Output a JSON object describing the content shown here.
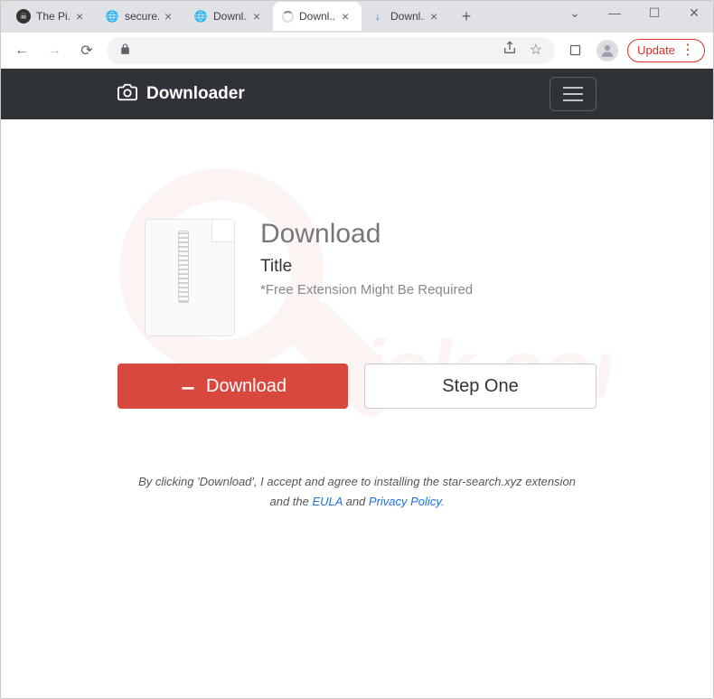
{
  "window": {
    "controls": {
      "dropdown": "⌄",
      "minimize": "—",
      "maximize": "☐",
      "close": "✕"
    }
  },
  "tabs": [
    {
      "label": "The Pi...",
      "favicon": "pirate"
    },
    {
      "label": "secure...",
      "favicon": "globe"
    },
    {
      "label": "Downl...",
      "favicon": "globe"
    },
    {
      "label": "Downl...",
      "favicon": "none",
      "active": true
    },
    {
      "label": "Downl...",
      "favicon": "download"
    }
  ],
  "toolbar": {
    "update_label": "Update"
  },
  "header": {
    "brand": "Downloader"
  },
  "page": {
    "heading": "Download",
    "subheading": "Title",
    "note": "*Free Extension Might Be Required",
    "download_btn": "Download",
    "step_btn": "Step One",
    "disclaimer_pre": "By clicking 'Download', I accept and agree to installing the star-search.xyz extension and the ",
    "eula": "EULA",
    "and": " and ",
    "privacy": "Privacy Policy",
    "period": "."
  }
}
